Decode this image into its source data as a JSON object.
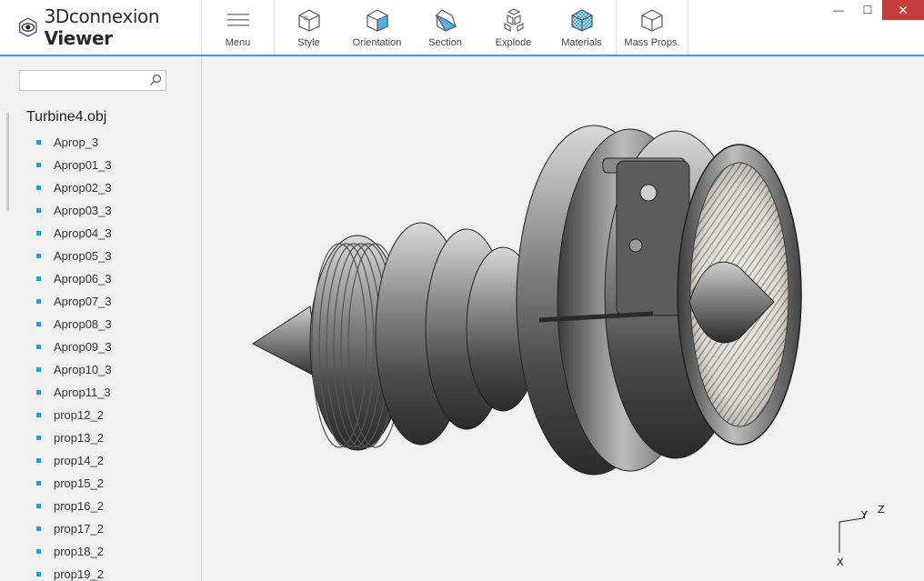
{
  "app": {
    "brand_light": "3Dconnexion ",
    "brand_bold": "Viewer",
    "accent_color": "#3d9fd6",
    "bullet_color": "#2d9ad8"
  },
  "toolbar": {
    "menu_label": "Menu",
    "style_label": "Style",
    "orientation_label": "Orientation",
    "section_label": "Section",
    "explode_label": "Explode",
    "materials_label": "Materials",
    "mass_label": "Mass Props."
  },
  "window_controls": {
    "minimize": "—",
    "maximize": "☐",
    "close": "✕"
  },
  "search": {
    "placeholder": "",
    "value": ""
  },
  "tree": {
    "root": "Turbine4.obj",
    "items": [
      "Aprop_3",
      "Aprop01_3",
      "Aprop02_3",
      "Aprop03_3",
      "Aprop04_3",
      "Aprop05_3",
      "Aprop06_3",
      "Aprop07_3",
      "Aprop08_3",
      "Aprop09_3",
      "Aprop10_3",
      "Aprop11_3",
      "prop12_2",
      "prop13_2",
      "prop14_2",
      "prop15_2",
      "prop16_2",
      "prop17_2",
      "prop18_2",
      "prop19_2"
    ]
  },
  "axes": {
    "x": "X",
    "y": "Y",
    "z": "Z"
  }
}
